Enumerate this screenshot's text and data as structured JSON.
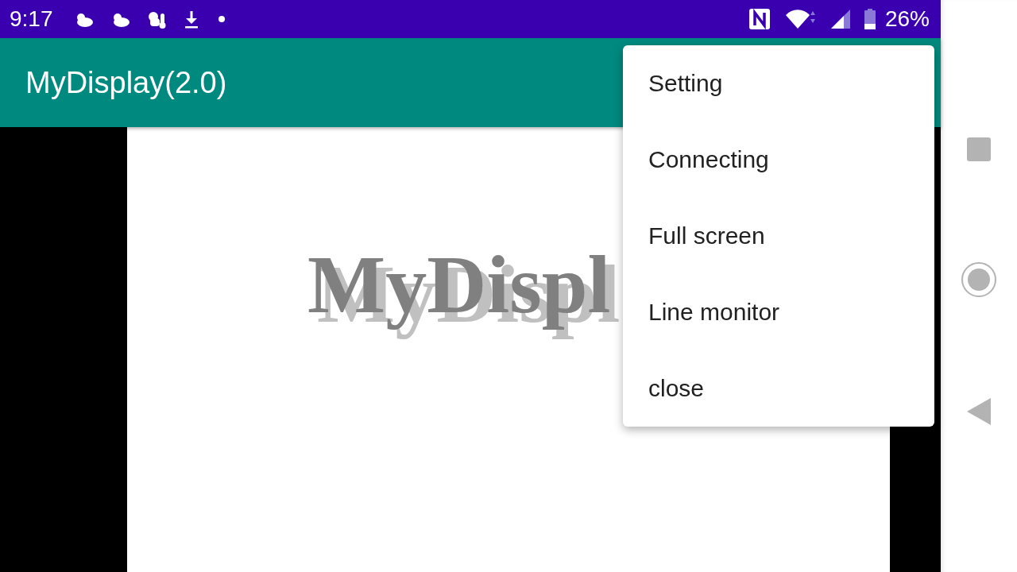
{
  "status_bar": {
    "time": "9:17",
    "battery_text": "26%"
  },
  "app_bar": {
    "title": "MyDisplay(2.0)"
  },
  "content": {
    "banner": "MyDispl"
  },
  "menu": {
    "items": [
      {
        "label": "Setting"
      },
      {
        "label": "Connecting"
      },
      {
        "label": "Full screen"
      },
      {
        "label": "Line monitor"
      },
      {
        "label": "close"
      }
    ]
  }
}
